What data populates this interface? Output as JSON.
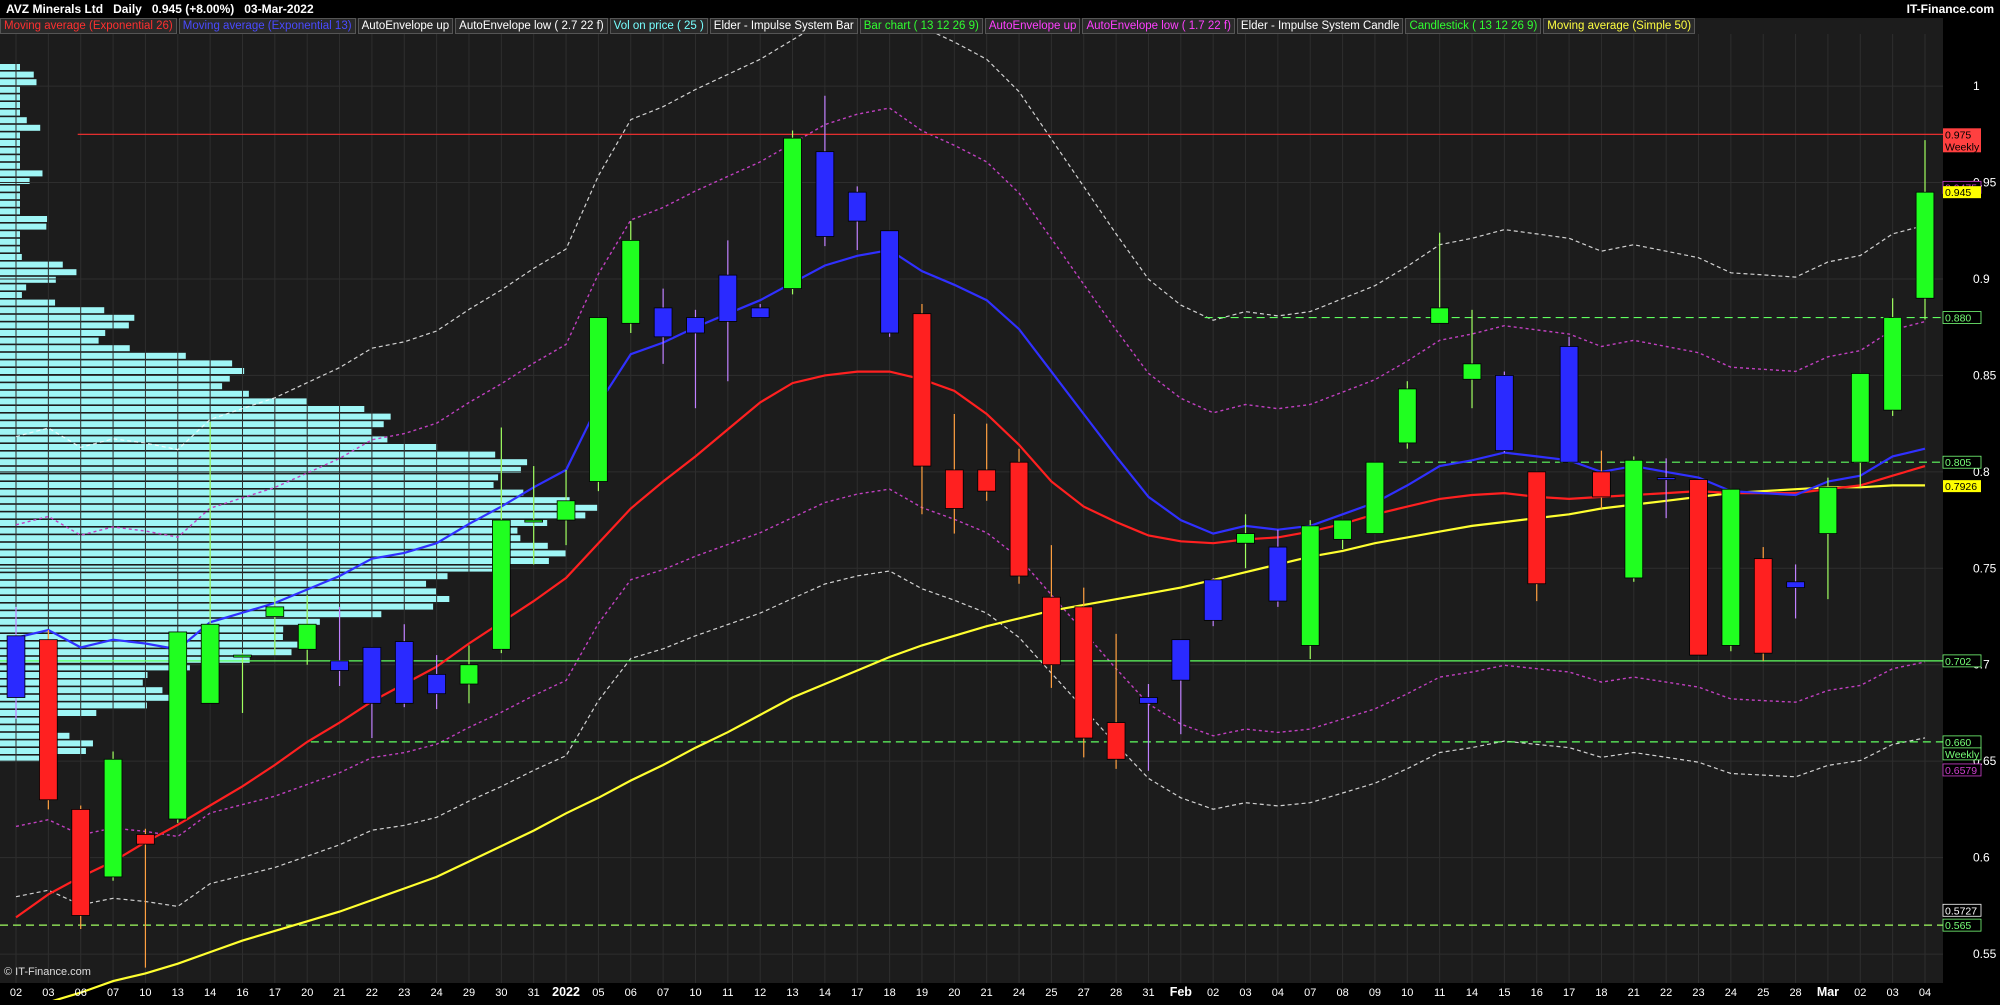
{
  "header": {
    "symbol": "AVZ Minerals Ltd",
    "interval": "Daily",
    "last": "0.945 (+8.00%)",
    "date": "03-Mar-2022",
    "site": "IT-Finance.com"
  },
  "footer": {
    "credit": "© IT-Finance.com"
  },
  "indicators": [
    {
      "label": "Moving average (Exponential 26)",
      "color": "#ff3030"
    },
    {
      "label": "Moving average (Exponential 13)",
      "color": "#4a4aff"
    },
    {
      "label": "AutoEnvelope up",
      "color": "#ffffff"
    },
    {
      "label": "AutoEnvelope low ( 2.7 22 f)",
      "color": "#ffffff"
    },
    {
      "label": "Vol on price ( 25 )",
      "color": "#7ff"
    },
    {
      "label": "Elder - Impulse System Bar",
      "color": "#ffffff"
    },
    {
      "label": "Bar chart ( 13 12 26 9)",
      "color": "#30ff30"
    },
    {
      "label": "AutoEnvelope up",
      "color": "#ff40ff"
    },
    {
      "label": "AutoEnvelope low ( 1.7 22 f)",
      "color": "#ff40ff"
    },
    {
      "label": "Elder - Impulse System Candle",
      "color": "#ffffff"
    },
    {
      "label": "Candlestick ( 13 12 26 9)",
      "color": "#30ff30"
    },
    {
      "label": "Moving average (Simple 50)",
      "color": "#ffff40"
    }
  ],
  "price_labels": [
    {
      "text": "0.975",
      "sub": "Weekly",
      "bg": "#ff4040",
      "fg": "#000",
      "value": 0.975
    },
    {
      "text": "0.9475",
      "bg": "#000",
      "fg": "#d040d0",
      "value": 0.9475
    },
    {
      "text": "0.945",
      "bg": "#ffff00",
      "fg": "#000",
      "value": 0.945
    },
    {
      "text": "0.880",
      "bg": "#000",
      "fg": "#7f7",
      "value": 0.88
    },
    {
      "text": "0.805",
      "bg": "#000",
      "fg": "#7f7",
      "value": 0.805
    },
    {
      "text": "0.7926",
      "bg": "#ffff00",
      "fg": "#000",
      "value": 0.7926
    },
    {
      "text": "0.702",
      "bg": "#000",
      "fg": "#7f7",
      "value": 0.702
    },
    {
      "text": "0.660",
      "bg": "#000",
      "fg": "#7f7",
      "value": 0.66
    },
    {
      "text": "Weekly",
      "bg": "#000",
      "fg": "#7f7",
      "value": 0.66
    },
    {
      "text": "0.6579",
      "bg": "#000",
      "fg": "#d040d0",
      "value": 0.6579
    },
    {
      "text": "0.5727",
      "bg": "#000",
      "fg": "#fff",
      "value": 0.5727
    },
    {
      "text": "0.565",
      "bg": "#000",
      "fg": "#7f7",
      "value": 0.565
    }
  ],
  "chart_data": {
    "type": "candlestick",
    "y_ticks": [
      1,
      0.95,
      0.9,
      0.85,
      0.8,
      0.75,
      0.7,
      0.65,
      0.6,
      0.55
    ],
    "x_labels": [
      "02",
      "03",
      "06",
      "07",
      "10",
      "13",
      "14",
      "16",
      "17",
      "20",
      "21",
      "22",
      "23",
      "24",
      "29",
      "30",
      "31",
      "2022",
      "05",
      "06",
      "07",
      "10",
      "11",
      "12",
      "13",
      "14",
      "17",
      "18",
      "19",
      "20",
      "21",
      "24",
      "25",
      "27",
      "28",
      "31",
      "Feb",
      "02",
      "03",
      "04",
      "07",
      "08",
      "09",
      "10",
      "11",
      "14",
      "15",
      "16",
      "17",
      "18",
      "21",
      "22",
      "23",
      "24",
      "25",
      "28",
      "Mar",
      "02",
      "03",
      "04"
    ],
    "candles": [
      {
        "o": 0.715,
        "h": 0.73,
        "l": 0.672,
        "c": 0.683,
        "k": "b"
      },
      {
        "o": 0.713,
        "h": 0.718,
        "l": 0.625,
        "c": 0.63,
        "k": "r"
      },
      {
        "o": 0.625,
        "h": 0.627,
        "l": 0.563,
        "c": 0.57,
        "k": "r"
      },
      {
        "o": 0.59,
        "h": 0.655,
        "l": 0.588,
        "c": 0.651,
        "k": "g"
      },
      {
        "o": 0.612,
        "h": 0.615,
        "l": 0.543,
        "c": 0.607,
        "k": "r"
      },
      {
        "o": 0.62,
        "h": 0.716,
        "l": 0.618,
        "c": 0.717,
        "k": "g"
      },
      {
        "o": 0.68,
        "h": 0.826,
        "l": 0.681,
        "c": 0.721,
        "k": "g"
      },
      {
        "o": 0.705,
        "h": 0.706,
        "l": 0.675,
        "c": 0.705,
        "k": "g"
      },
      {
        "o": 0.725,
        "h": 0.735,
        "l": 0.705,
        "c": 0.73,
        "k": "g"
      },
      {
        "o": 0.708,
        "h": 0.736,
        "l": 0.7,
        "c": 0.721,
        "k": "g"
      },
      {
        "o": 0.702,
        "h": 0.73,
        "l": 0.689,
        "c": 0.697,
        "k": "b"
      },
      {
        "o": 0.68,
        "h": 0.707,
        "l": 0.662,
        "c": 0.709,
        "k": "b"
      },
      {
        "o": 0.68,
        "h": 0.721,
        "l": 0.678,
        "c": 0.712,
        "k": "b"
      },
      {
        "o": 0.685,
        "h": 0.705,
        "l": 0.677,
        "c": 0.695,
        "k": "b"
      },
      {
        "o": 0.69,
        "h": 0.71,
        "l": 0.68,
        "c": 0.7,
        "k": "g"
      },
      {
        "o": 0.708,
        "h": 0.823,
        "l": 0.706,
        "c": 0.775,
        "k": "g"
      },
      {
        "o": 0.775,
        "h": 0.803,
        "l": 0.752,
        "c": 0.775,
        "k": "g"
      },
      {
        "o": 0.775,
        "h": 0.801,
        "l": 0.762,
        "c": 0.785,
        "k": "g"
      },
      {
        "o": 0.795,
        "h": 0.849,
        "l": 0.79,
        "c": 0.88,
        "k": "g"
      },
      {
        "o": 0.877,
        "h": 0.93,
        "l": 0.872,
        "c": 0.92,
        "k": "g"
      },
      {
        "o": 0.885,
        "h": 0.895,
        "l": 0.856,
        "c": 0.87,
        "k": "b"
      },
      {
        "o": 0.88,
        "h": 0.884,
        "l": 0.833,
        "c": 0.872,
        "k": "b"
      },
      {
        "o": 0.902,
        "h": 0.92,
        "l": 0.847,
        "c": 0.878,
        "k": "b"
      },
      {
        "o": 0.885,
        "h": 0.887,
        "l": 0.88,
        "c": 0.88,
        "k": "b"
      },
      {
        "o": 0.895,
        "h": 0.977,
        "l": 0.892,
        "c": 0.973,
        "k": "g"
      },
      {
        "o": 0.966,
        "h": 0.995,
        "l": 0.917,
        "c": 0.922,
        "k": "b"
      },
      {
        "o": 0.945,
        "h": 0.948,
        "l": 0.915,
        "c": 0.93,
        "k": "b"
      },
      {
        "o": 0.925,
        "h": 0.925,
        "l": 0.87,
        "c": 0.872,
        "k": "b"
      },
      {
        "o": 0.882,
        "h": 0.887,
        "l": 0.778,
        "c": 0.803,
        "k": "r"
      },
      {
        "o": 0.801,
        "h": 0.83,
        "l": 0.768,
        "c": 0.781,
        "k": "r"
      },
      {
        "o": 0.801,
        "h": 0.825,
        "l": 0.785,
        "c": 0.79,
        "k": "r"
      },
      {
        "o": 0.805,
        "h": 0.812,
        "l": 0.742,
        "c": 0.746,
        "k": "r"
      },
      {
        "o": 0.735,
        "h": 0.762,
        "l": 0.688,
        "c": 0.7,
        "k": "r"
      },
      {
        "o": 0.73,
        "h": 0.74,
        "l": 0.652,
        "c": 0.662,
        "k": "r"
      },
      {
        "o": 0.67,
        "h": 0.716,
        "l": 0.646,
        "c": 0.651,
        "k": "r"
      },
      {
        "o": 0.68,
        "h": 0.69,
        "l": 0.645,
        "c": 0.683,
        "k": "b"
      },
      {
        "o": 0.692,
        "h": 0.713,
        "l": 0.664,
        "c": 0.713,
        "k": "b"
      },
      {
        "o": 0.723,
        "h": 0.745,
        "l": 0.72,
        "c": 0.744,
        "k": "b"
      },
      {
        "o": 0.768,
        "h": 0.778,
        "l": 0.75,
        "c": 0.763,
        "k": "g"
      },
      {
        "o": 0.733,
        "h": 0.77,
        "l": 0.73,
        "c": 0.761,
        "k": "b"
      },
      {
        "o": 0.71,
        "h": 0.775,
        "l": 0.703,
        "c": 0.772,
        "k": "g"
      },
      {
        "o": 0.765,
        "h": 0.774,
        "l": 0.76,
        "c": 0.775,
        "k": "g"
      },
      {
        "o": 0.768,
        "h": 0.802,
        "l": 0.768,
        "c": 0.805,
        "k": "g"
      },
      {
        "o": 0.815,
        "h": 0.847,
        "l": 0.812,
        "c": 0.843,
        "k": "g"
      },
      {
        "o": 0.885,
        "h": 0.924,
        "l": 0.877,
        "c": 0.877,
        "k": "g"
      },
      {
        "o": 0.848,
        "h": 0.884,
        "l": 0.833,
        "c": 0.856,
        "k": "g"
      },
      {
        "o": 0.85,
        "h": 0.852,
        "l": 0.81,
        "c": 0.811,
        "k": "b"
      },
      {
        "o": 0.8,
        "h": 0.8,
        "l": 0.733,
        "c": 0.742,
        "k": "r"
      },
      {
        "o": 0.865,
        "h": 0.87,
        "l": 0.805,
        "c": 0.805,
        "k": "b"
      },
      {
        "o": 0.8,
        "h": 0.811,
        "l": 0.781,
        "c": 0.787,
        "k": "r"
      },
      {
        "o": 0.745,
        "h": 0.808,
        "l": 0.743,
        "c": 0.806,
        "k": "g"
      },
      {
        "o": 0.796,
        "h": 0.807,
        "l": 0.776,
        "c": 0.797,
        "k": "b"
      },
      {
        "o": 0.796,
        "h": 0.793,
        "l": 0.706,
        "c": 0.705,
        "k": "r"
      },
      {
        "o": 0.71,
        "h": 0.787,
        "l": 0.707,
        "c": 0.791,
        "k": "g"
      },
      {
        "o": 0.755,
        "h": 0.761,
        "l": 0.702,
        "c": 0.706,
        "k": "r"
      },
      {
        "o": 0.74,
        "h": 0.752,
        "l": 0.724,
        "c": 0.743,
        "k": "b"
      },
      {
        "o": 0.768,
        "h": 0.797,
        "l": 0.734,
        "c": 0.792,
        "k": "g"
      },
      {
        "o": 0.805,
        "h": 0.849,
        "l": 0.792,
        "c": 0.851,
        "k": "g"
      },
      {
        "o": 0.832,
        "h": 0.89,
        "l": 0.829,
        "c": 0.88,
        "k": "g"
      },
      {
        "o": 0.89,
        "h": 0.972,
        "l": 0.879,
        "c": 0.945,
        "k": "g"
      }
    ],
    "ema13": [
      0.714,
      0.718,
      0.709,
      0.713,
      0.711,
      0.708,
      0.722,
      0.727,
      0.732,
      0.739,
      0.746,
      0.755,
      0.758,
      0.763,
      0.773,
      0.782,
      0.792,
      0.801,
      0.835,
      0.861,
      0.867,
      0.875,
      0.882,
      0.889,
      0.898,
      0.907,
      0.912,
      0.915,
      0.904,
      0.897,
      0.889,
      0.874,
      0.852,
      0.83,
      0.808,
      0.787,
      0.775,
      0.768,
      0.772,
      0.77,
      0.772,
      0.778,
      0.784,
      0.793,
      0.803,
      0.806,
      0.81,
      0.808,
      0.806,
      0.8,
      0.803,
      0.8,
      0.797,
      0.79,
      0.789,
      0.788,
      0.795,
      0.798,
      0.808,
      0.812
    ],
    "ema26": [
      0.569,
      0.581,
      0.59,
      0.598,
      0.608,
      0.617,
      0.627,
      0.637,
      0.648,
      0.66,
      0.67,
      0.681,
      0.69,
      0.699,
      0.711,
      0.722,
      0.733,
      0.745,
      0.763,
      0.781,
      0.795,
      0.808,
      0.822,
      0.836,
      0.846,
      0.85,
      0.852,
      0.852,
      0.848,
      0.842,
      0.83,
      0.814,
      0.795,
      0.782,
      0.774,
      0.767,
      0.764,
      0.763,
      0.765,
      0.766,
      0.769,
      0.773,
      0.778,
      0.782,
      0.786,
      0.788,
      0.789,
      0.787,
      0.786,
      0.787,
      0.788,
      0.789,
      0.79,
      0.789,
      0.789,
      0.789,
      0.791,
      0.793,
      0.798,
      0.803
    ],
    "sma50": [
      0.52,
      0.525,
      0.53,
      0.536,
      0.54,
      0.545,
      0.551,
      0.557,
      0.562,
      0.567,
      0.572,
      0.578,
      0.584,
      0.59,
      0.598,
      0.606,
      0.614,
      0.623,
      0.631,
      0.64,
      0.648,
      0.657,
      0.665,
      0.674,
      0.683,
      0.69,
      0.697,
      0.704,
      0.71,
      0.715,
      0.72,
      0.724,
      0.728,
      0.731,
      0.734,
      0.737,
      0.74,
      0.744,
      0.748,
      0.752,
      0.756,
      0.759,
      0.763,
      0.766,
      0.769,
      0.772,
      0.774,
      0.776,
      0.778,
      0.781,
      0.783,
      0.785,
      0.787,
      0.789,
      0.79,
      0.791,
      0.792,
      0.792,
      0.793,
      0.793
    ],
    "hlines": [
      {
        "value": 0.975,
        "color": "#ff3030",
        "style": "solid",
        "from": 0.04
      },
      {
        "value": 0.88,
        "color": "#60ff60",
        "style": "dashed",
        "from": 0.62
      },
      {
        "value": 0.805,
        "color": "#60ff60",
        "style": "dashed",
        "from": 0.72
      },
      {
        "value": 0.702,
        "color": "#60ff60",
        "style": "solid",
        "from": 0.0
      },
      {
        "value": 0.66,
        "color": "#60ff60",
        "style": "dashed",
        "from": 0.16
      },
      {
        "value": 0.565,
        "color": "#a0ff60",
        "style": "dashed",
        "from": 0.0
      }
    ]
  }
}
